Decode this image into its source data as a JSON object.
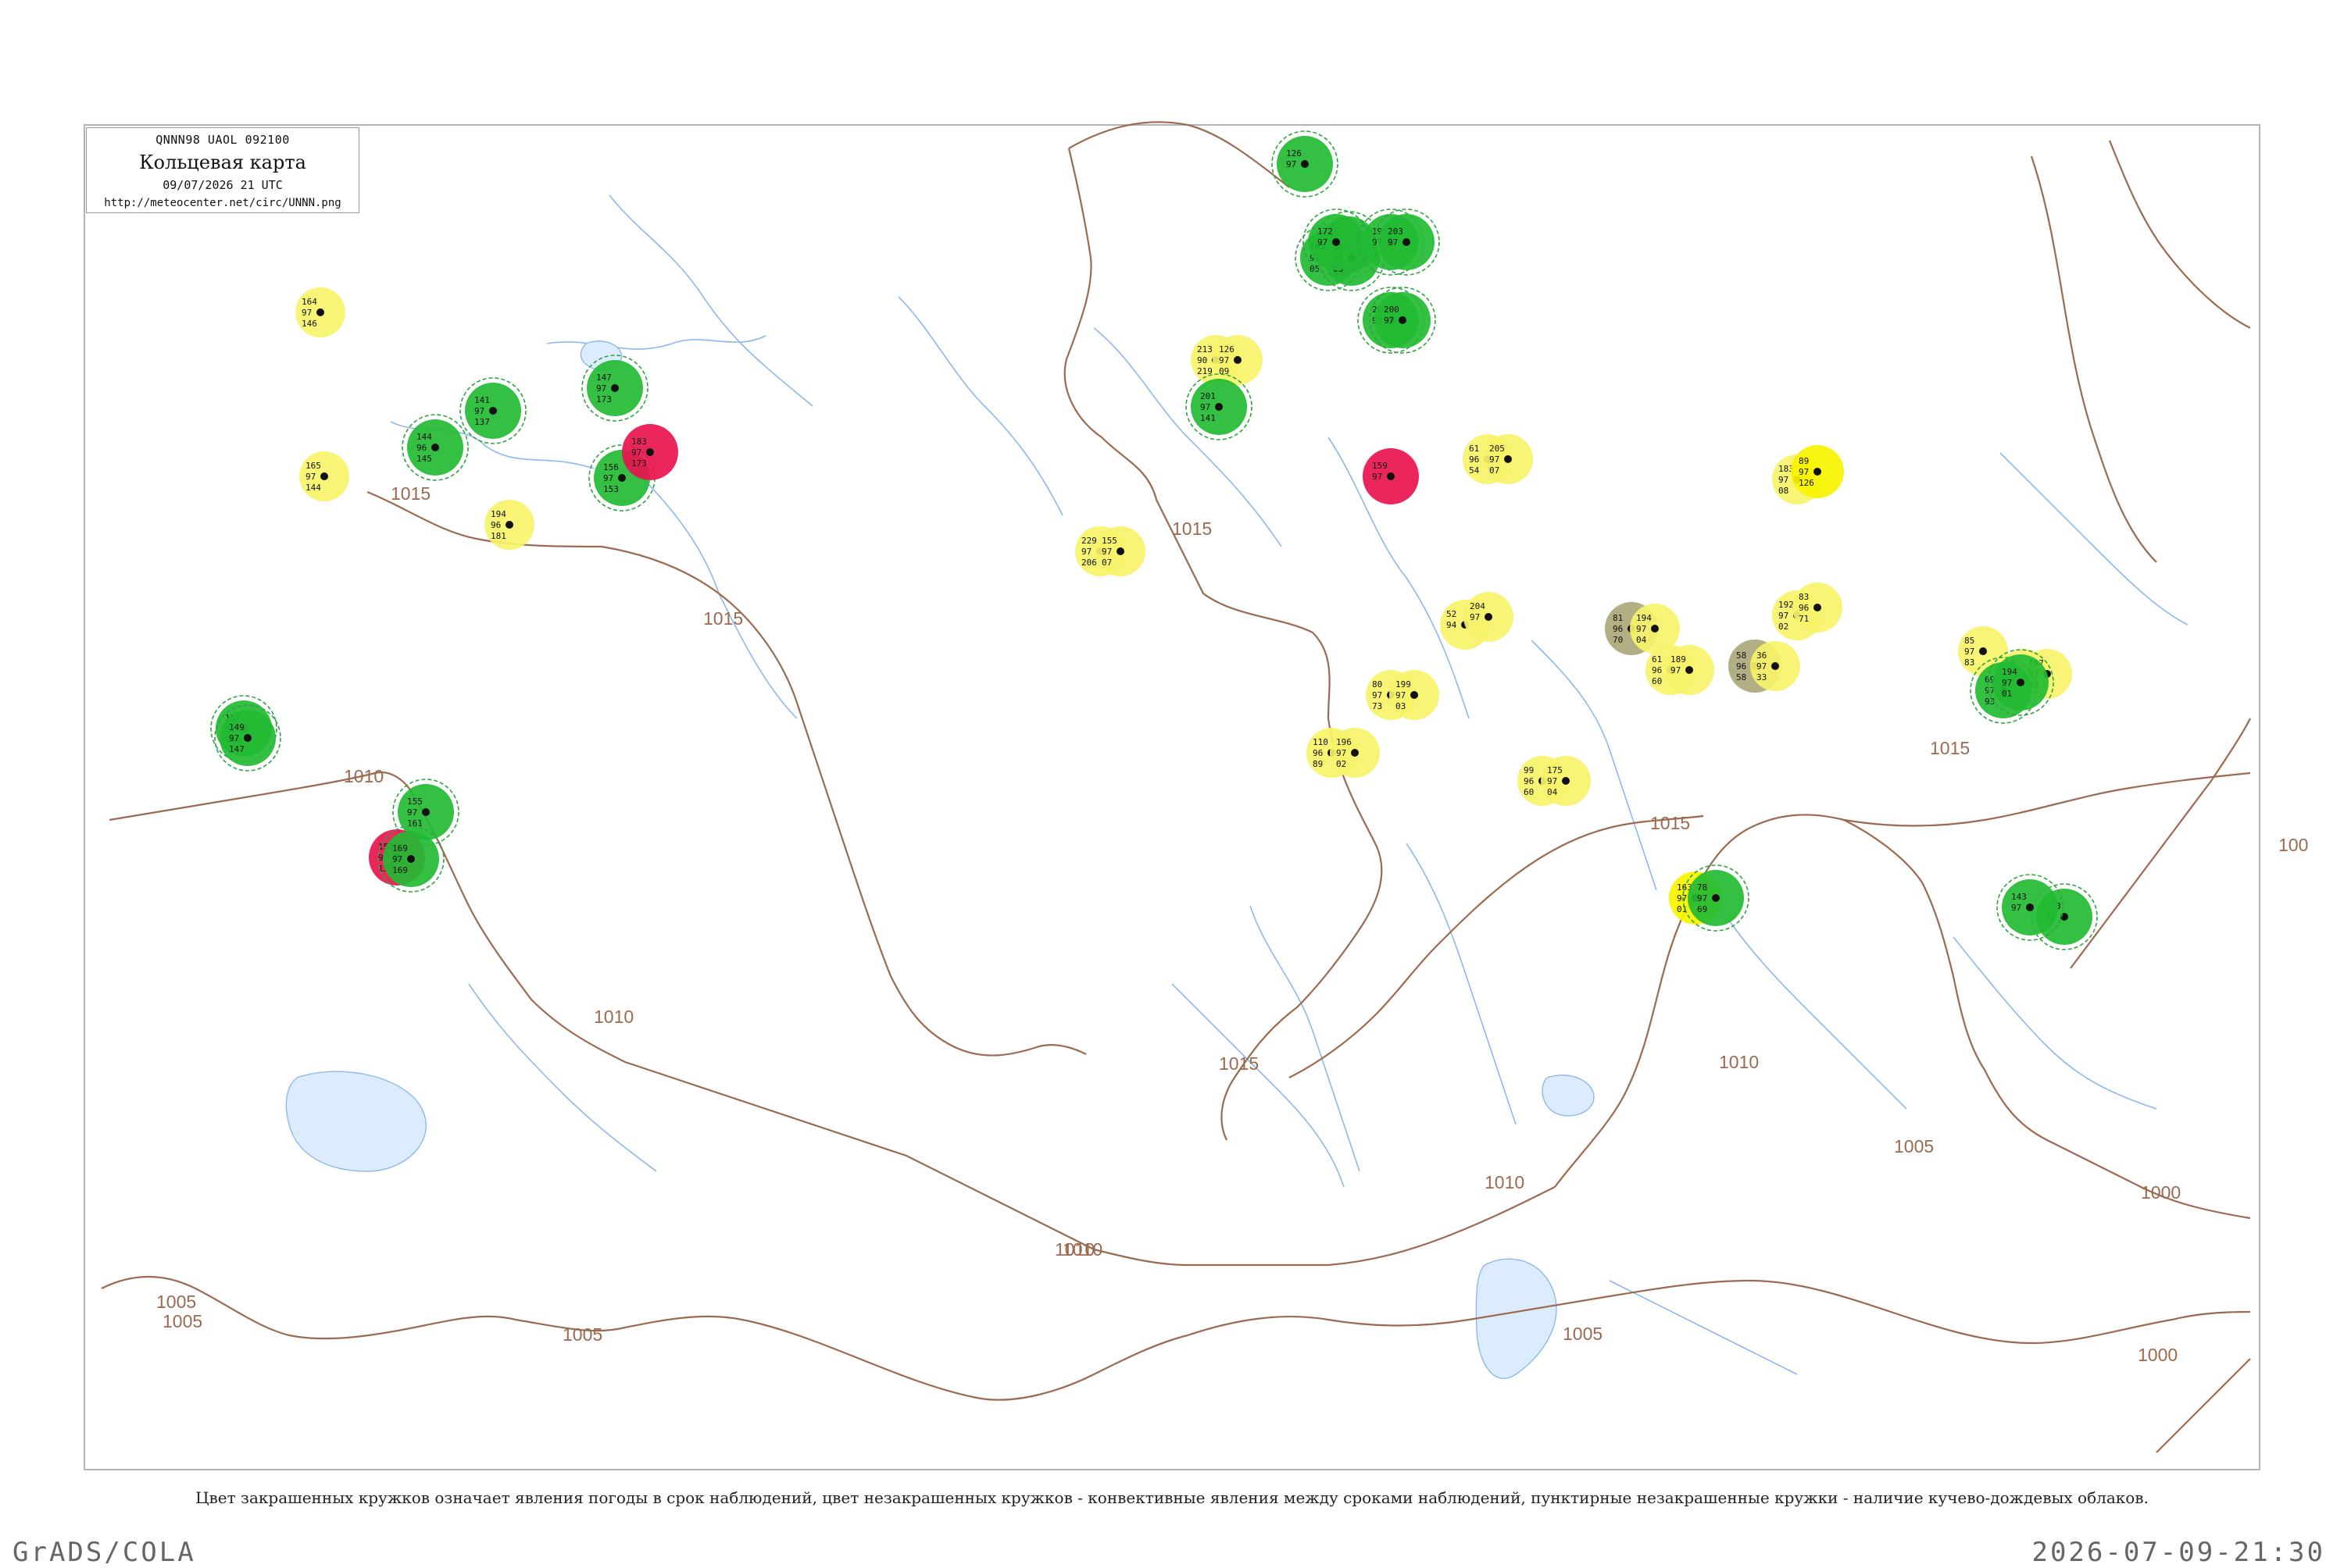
{
  "header": {
    "code_line": "QNNN98  UAOL  092100",
    "title": "Кольцевая карта",
    "datetime": "09/07/2026 21 UTC",
    "url": "http://meteocenter.net/circ/UNNN.png"
  },
  "footnote": "Цвет закрашенных кружков означает явления погоды в срок наблюдений, цвет незакрашенных кружков - конвективные явления между сроками наблюдений, пунктирные незакрашенные кружки - наличие кучево-дождевых облаков.",
  "software_label": "GrADS/COLA",
  "render_timestamp": "2026-07-09-21:30",
  "colors": {
    "isobar": "#9c6a50",
    "river": "#8cb8ee",
    "rain": "#22bb33",
    "rain_ring": "#2fa33f",
    "thunder": "#e8144e",
    "haze": "#f6f36a",
    "fog": "#aaa878",
    "cb_dashed": "#2fa33f",
    "frame": "#b4b4b4"
  },
  "chart_data": {
    "type": "synoptic-map",
    "isobar_labels": [
      {
        "value": "1015"
      },
      {
        "value": "1015"
      },
      {
        "value": "1015"
      },
      {
        "value": "1015"
      },
      {
        "value": "1015"
      },
      {
        "value": "1015"
      },
      {
        "value": "1010"
      },
      {
        "value": "1010"
      },
      {
        "value": "1010"
      },
      {
        "value": "1010"
      },
      {
        "value": "1010"
      },
      {
        "value": "1010"
      },
      {
        "value": "1005"
      },
      {
        "value": "1005"
      },
      {
        "value": "1005"
      },
      {
        "value": "1005"
      },
      {
        "value": "1005"
      },
      {
        "value": "1000"
      },
      {
        "value": "1000"
      },
      {
        "value": "100"
      }
    ],
    "stations": [
      {
        "top": "164",
        "mid": "97",
        "bot": "146",
        "kind": "haze"
      },
      {
        "top": "165",
        "mid": "97",
        "bot": "144",
        "kind": "haze"
      },
      {
        "top": "194",
        "mid": "96",
        "bot": "181",
        "kind": "haze"
      },
      {
        "top": "144",
        "mid": "96",
        "bot": "145",
        "kind": "rain"
      },
      {
        "top": "152",
        "mid": "97",
        "bot": "148",
        "kind": "rain"
      },
      {
        "top": "149",
        "mid": "97",
        "bot": "147",
        "kind": "rain"
      },
      {
        "top": "155",
        "mid": "97",
        "bot": "161",
        "kind": "rain"
      },
      {
        "top": "159",
        "mid": "97",
        "bot": "150",
        "kind": "thunder"
      },
      {
        "top": "141",
        "mid": "97",
        "bot": "137",
        "kind": "rain"
      },
      {
        "top": "147",
        "mid": "97",
        "bot": "173",
        "kind": "rain"
      },
      {
        "top": "156",
        "mid": "97",
        "bot": "153",
        "kind": "rain"
      },
      {
        "top": "183",
        "mid": "97",
        "bot": "173",
        "kind": "thunder"
      },
      {
        "top": "169",
        "mid": "97",
        "bot": "169",
        "kind": "rain"
      },
      {
        "top": "229",
        "mid": "97",
        "bot": "206",
        "kind": "haze"
      },
      {
        "top": "155",
        "mid": "97",
        "bot": "07",
        "kind": "haze"
      },
      {
        "top": "213",
        "mid": "90",
        "bot": "219",
        "kind": "haze"
      },
      {
        "top": "126",
        "mid": "97",
        "bot": "09",
        "kind": "haze"
      },
      {
        "top": "201",
        "mid": "97",
        "bot": "141",
        "kind": "rain"
      },
      {
        "top": "118",
        "mid": "97",
        "bot": "",
        "kind": "rain"
      },
      {
        "top": "164",
        "mid": "97",
        "bot": "05",
        "kind": "rain"
      },
      {
        "top": "167",
        "mid": "97",
        "bot": "03",
        "kind": "rain"
      },
      {
        "top": "80",
        "mid": "97",
        "bot": "73",
        "kind": "haze"
      },
      {
        "top": "199",
        "mid": "97",
        "bot": "03",
        "kind": "haze"
      },
      {
        "top": "110",
        "mid": "96",
        "bot": "89",
        "kind": "haze"
      },
      {
        "top": "196",
        "mid": "97",
        "bot": "02",
        "kind": "haze"
      },
      {
        "top": "52",
        "mid": "94",
        "bot": "",
        "kind": "haze"
      },
      {
        "top": "204",
        "mid": "97",
        "bot": "",
        "kind": "haze"
      },
      {
        "top": "61",
        "mid": "96",
        "bot": "54",
        "kind": "haze"
      },
      {
        "top": "205",
        "mid": "97",
        "bot": "07",
        "kind": "haze"
      },
      {
        "top": "99",
        "mid": "96",
        "bot": "60",
        "kind": "haze"
      },
      {
        "top": "175",
        "mid": "97",
        "bot": "04",
        "kind": "haze"
      },
      {
        "top": "81",
        "mid": "96",
        "bot": "70",
        "kind": "fog"
      },
      {
        "top": "194",
        "mid": "97",
        "bot": "04",
        "kind": "haze"
      },
      {
        "top": "61",
        "mid": "96",
        "bot": "60",
        "kind": "haze"
      },
      {
        "top": "189",
        "mid": "97",
        "bot": "",
        "kind": "haze"
      },
      {
        "top": "58",
        "mid": "96",
        "bot": "58",
        "kind": "fog"
      },
      {
        "top": "36",
        "mid": "97",
        "bot": "33",
        "kind": "haze"
      },
      {
        "top": "192",
        "mid": "97",
        "bot": "02",
        "kind": "haze"
      },
      {
        "top": "83",
        "mid": "96",
        "bot": "71",
        "kind": "haze"
      },
      {
        "top": "183",
        "mid": "97",
        "bot": "08",
        "kind": "haze"
      },
      {
        "top": "89",
        "mid": "97",
        "bot": "126",
        "kind": "yellow"
      },
      {
        "top": "163",
        "mid": "97",
        "bot": "01",
        "kind": "yellow"
      },
      {
        "top": "78",
        "mid": "97",
        "bot": "69",
        "kind": "rain"
      },
      {
        "top": "50",
        "mid": "96",
        "bot": "45",
        "kind": "haze"
      },
      {
        "top": "167",
        "mid": "97",
        "bot": "03",
        "kind": "haze"
      },
      {
        "top": "85",
        "mid": "97",
        "bot": "83",
        "kind": "haze"
      },
      {
        "top": "69",
        "mid": "97",
        "bot": "93",
        "kind": "rain"
      },
      {
        "top": "194",
        "mid": "97",
        "bot": "01",
        "kind": "rain"
      },
      {
        "top": "133",
        "mid": "97",
        "bot": "",
        "kind": "rain"
      },
      {
        "top": "143",
        "mid": "97",
        "bot": "",
        "kind": "rain"
      },
      {
        "top": "126",
        "mid": "97",
        "bot": "",
        "kind": "rain"
      },
      {
        "top": "172",
        "mid": "97",
        "bot": "",
        "kind": "rain"
      },
      {
        "top": "197",
        "mid": "97",
        "bot": "",
        "kind": "rain"
      },
      {
        "top": "204",
        "mid": "97",
        "bot": "",
        "kind": "rain"
      },
      {
        "top": "159",
        "mid": "97",
        "bot": "",
        "kind": "thunder"
      },
      {
        "top": "203",
        "mid": "97",
        "bot": "",
        "kind": "rain"
      },
      {
        "top": "200",
        "mid": "97",
        "bot": "",
        "kind": "rain"
      }
    ]
  }
}
